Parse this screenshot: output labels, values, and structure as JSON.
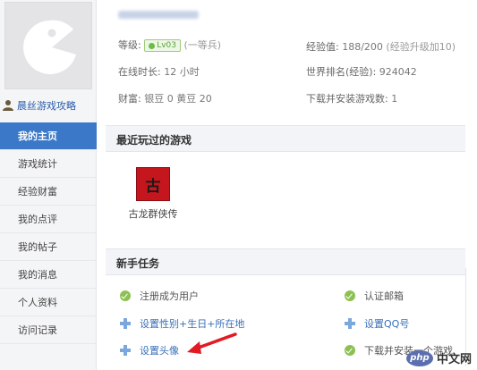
{
  "sidebar": {
    "username": "晨丝游戏攻略",
    "menu": [
      {
        "label": "我的主页",
        "active": true
      },
      {
        "label": "游戏统计",
        "active": false
      },
      {
        "label": "经验财富",
        "active": false
      },
      {
        "label": "我的点评",
        "active": false
      },
      {
        "label": "我的帖子",
        "active": false
      },
      {
        "label": "我的消息",
        "active": false
      },
      {
        "label": "个人资料",
        "active": false
      },
      {
        "label": "访问记录",
        "active": false
      }
    ]
  },
  "profile": {
    "level_label": "等级:",
    "level_badge": "Lv03",
    "level_title": "(一等兵)",
    "online_label": "在线时长:",
    "online_value": "12 小时",
    "wealth_label": "财富:",
    "wealth_value": "银豆 0  黄豆 20",
    "exp_label": "经验值:",
    "exp_value": "188/200",
    "exp_note": "(经验升级加10)",
    "rank_label": "世界排名(经验):",
    "rank_value": "924042",
    "downloads_label": "下载并安装游戏数:",
    "downloads_value": "1"
  },
  "recent": {
    "title": "最近玩过的游戏",
    "games": [
      {
        "label": "古龙群侠传",
        "thumb_text": "古"
      }
    ]
  },
  "tasks": {
    "title": "新手任务",
    "items": [
      {
        "label": "注册成为用户",
        "done": true
      },
      {
        "label": "认证邮箱",
        "done": true
      },
      {
        "label": "设置性别+生日+所在地",
        "done": false
      },
      {
        "label": "设置QQ号",
        "done": false
      },
      {
        "label": "设置头像",
        "done": false
      },
      {
        "label": "下载并安装一个游戏",
        "done": true
      }
    ]
  },
  "watermark": {
    "logo": "php",
    "text": "中文网"
  },
  "colors": {
    "accent": "#3b78c7",
    "link": "#3a6fb8",
    "done_green": "#8cc152",
    "arrow_red": "#e01b24"
  }
}
